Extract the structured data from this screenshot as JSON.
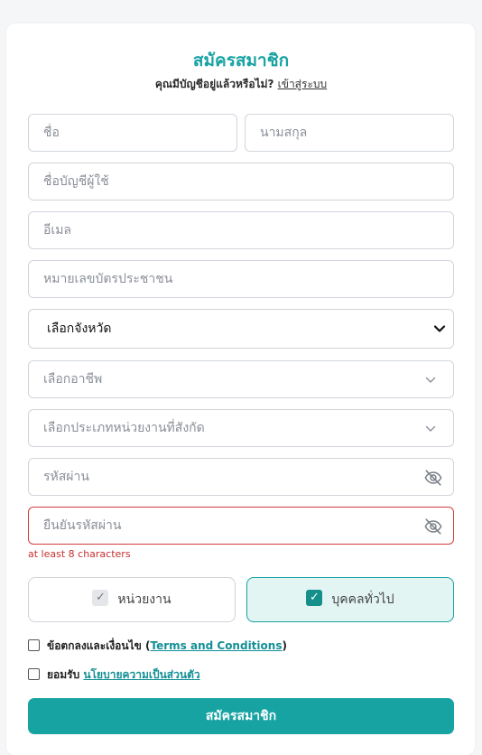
{
  "form": {
    "title": "สมัครสมาชิก",
    "subtitle_prefix": "คุณมีบัญชีอยู่แล้วหรือไม่?",
    "login_link": "เข้าสู่ระบบ"
  },
  "fields": {
    "first_name_placeholder": "ชื่อ",
    "last_name_placeholder": "นามสกุล",
    "username_placeholder": "ชื่อบัญชีผู้ใช้",
    "email_placeholder": "อีเมล",
    "id_card_placeholder": "หมายเลขบัตรประชาชน",
    "province_select": "เลือกจังหวัด",
    "occupation_select": "เลือกอาชีพ",
    "agency_type_select": "เลือกประเภทหน่วยงานที่สังกัด",
    "password_placeholder": "รหัสผ่าน",
    "confirm_password_placeholder": "ยืนยันรหัสผ่าน",
    "password_error": "at least 8 characters"
  },
  "user_type": {
    "agency_label": "หน่วยงาน",
    "general_label": "บุคคลทั่วไป",
    "selected": "general"
  },
  "agreements": {
    "terms_prefix": "ข้อตกลงและเงื่อนไข (",
    "terms_link": "Terms and Conditions",
    "terms_suffix": ")",
    "privacy_prefix": "ยอมรับ",
    "privacy_link": "นโยบายความเป็นส่วนตัว"
  },
  "submit_label": "สมัครสมาชิก",
  "colors": {
    "accent": "#18a3a3",
    "error": "#d63b3b",
    "selected_bg": "#e2f5f3"
  },
  "icons": {
    "select_arrow": "chevron-down-icon",
    "password_toggle": "eye-off-icon",
    "check": "check-icon"
  }
}
